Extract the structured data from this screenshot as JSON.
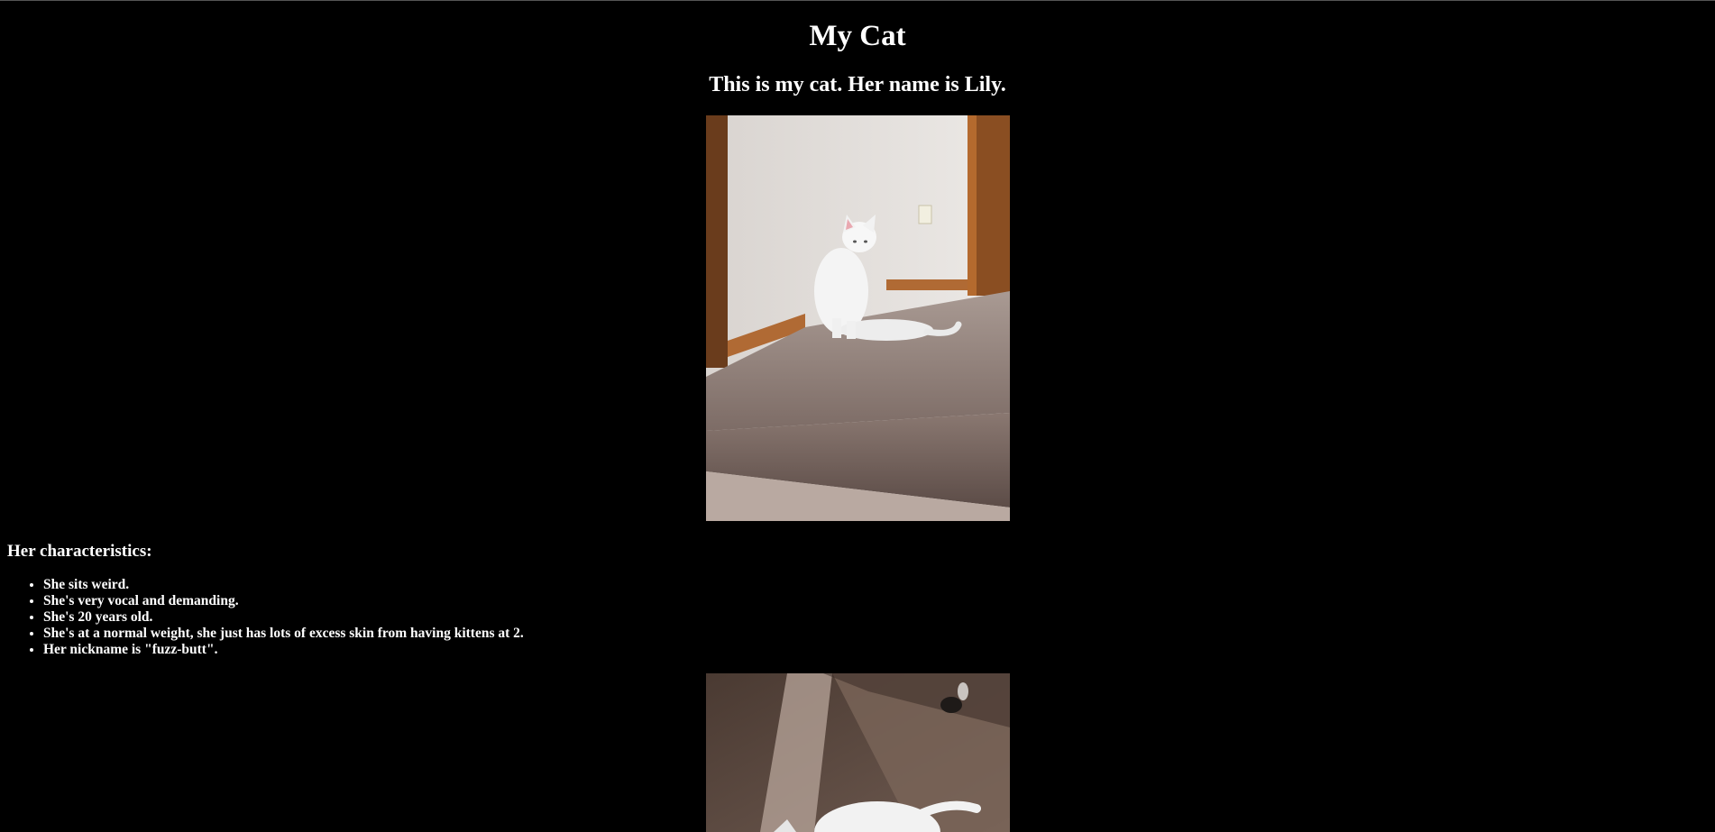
{
  "page": {
    "title": "My Cat",
    "subtitle": "This is my cat. Her name is Lily."
  },
  "characteristics": {
    "heading": "Her characteristics:",
    "items": [
      "She sits weird.",
      "She's very vocal and demanding.",
      "She's 20 years old.",
      "She's at a normal weight, she just has lots of excess skin from having kittens at 2.",
      "Her nickname is \"fuzz-butt\"."
    ]
  },
  "colors": {
    "background": "#000000",
    "text": "#ffffff"
  }
}
